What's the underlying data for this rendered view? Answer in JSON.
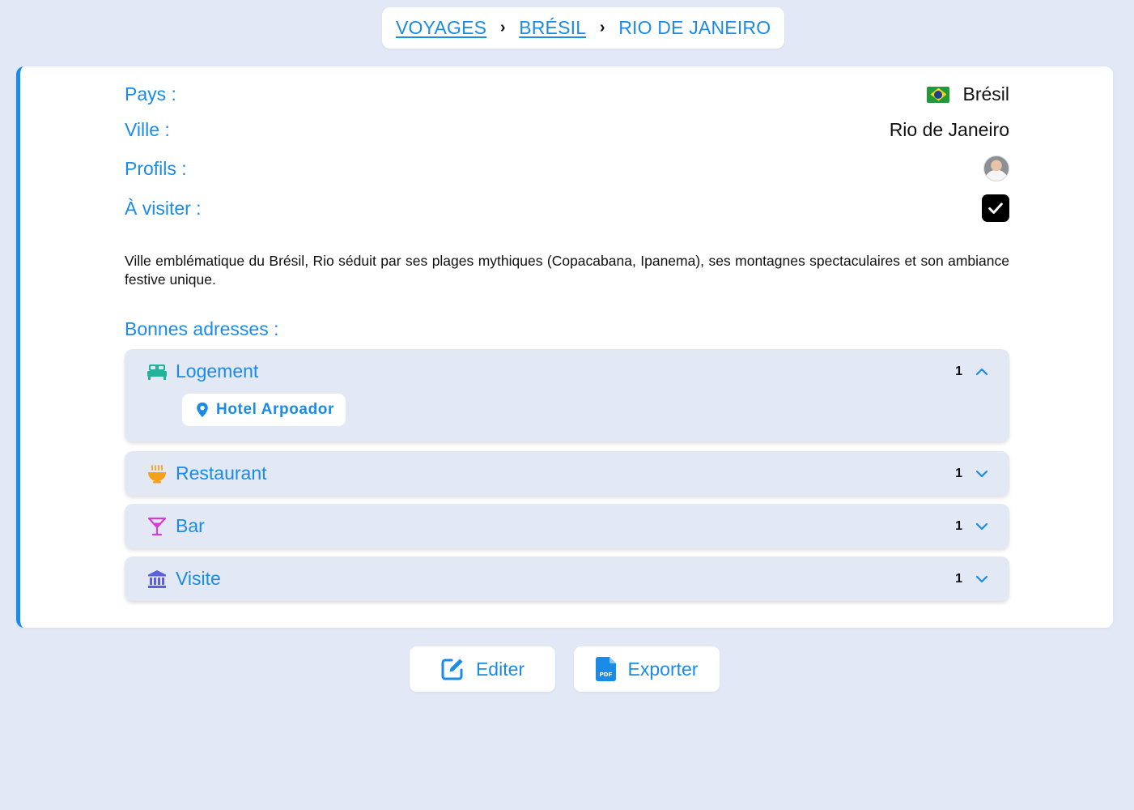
{
  "breadcrumb": {
    "items": [
      {
        "label": "VOYAGES"
      },
      {
        "label": "BRÉSIL"
      },
      {
        "label": "RIO DE JANEIRO"
      }
    ],
    "separator": "›"
  },
  "details": {
    "country_label": "Pays :",
    "country_value": "Brésil",
    "country_flag_icon": "brazil-flag-icon",
    "city_label": "Ville :",
    "city_value": "Rio de Janeiro",
    "profiles_label": "Profils :",
    "to_visit_label": "À visiter :",
    "to_visit_checked": true
  },
  "description": "Ville emblématique du Brésil, Rio séduit par ses plages mythiques (Copacabana, Ipanema), ses montagnes spectaculaires et son ambiance festive unique.",
  "addresses": {
    "title": "Bonnes adresses :",
    "categories": [
      {
        "name": "Logement",
        "count": "1",
        "icon": "bed-icon",
        "color": "#23b39a",
        "expanded": true,
        "places": [
          "Hotel Arpoador"
        ]
      },
      {
        "name": "Restaurant",
        "count": "1",
        "icon": "food-bowl-icon",
        "color": "#f5a019",
        "expanded": false
      },
      {
        "name": "Bar",
        "count": "1",
        "icon": "cocktail-icon",
        "color": "#d63dd4",
        "expanded": false
      },
      {
        "name": "Visite",
        "count": "1",
        "icon": "museum-icon",
        "color": "#5b5fe0",
        "expanded": false
      }
    ]
  },
  "actions": {
    "edit_label": "Editer",
    "export_label": "Exporter"
  },
  "colors": {
    "accent": "#1a8be6",
    "background": "#e2e8f5"
  }
}
